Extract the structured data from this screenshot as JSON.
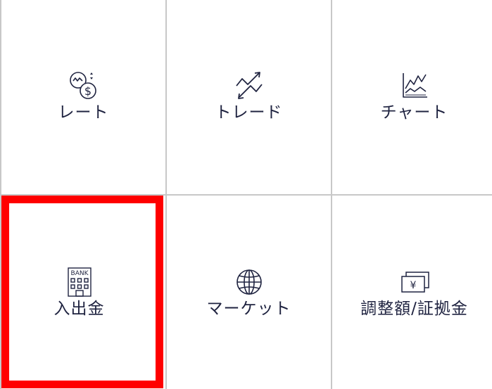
{
  "menu": {
    "items": [
      {
        "key": "rate",
        "label": "レート",
        "icon": "rate-exchange-icon"
      },
      {
        "key": "trade",
        "label": "トレード",
        "icon": "trade-arrows-icon"
      },
      {
        "key": "chart",
        "label": "チャート",
        "icon": "line-chart-icon"
      },
      {
        "key": "deposit",
        "label": "入出金",
        "icon": "bank-icon",
        "bank_text": "BANK",
        "highlighted": true
      },
      {
        "key": "market",
        "label": "マーケット",
        "icon": "globe-icon"
      },
      {
        "key": "margin",
        "label": "調整額/証拠金",
        "icon": "yen-bills-icon",
        "currency_symbol": "¥"
      }
    ]
  },
  "colors": {
    "text": "#1f2340",
    "divider": "#c8c8c8",
    "highlight": "#ff0000",
    "background": "#ffffff"
  }
}
